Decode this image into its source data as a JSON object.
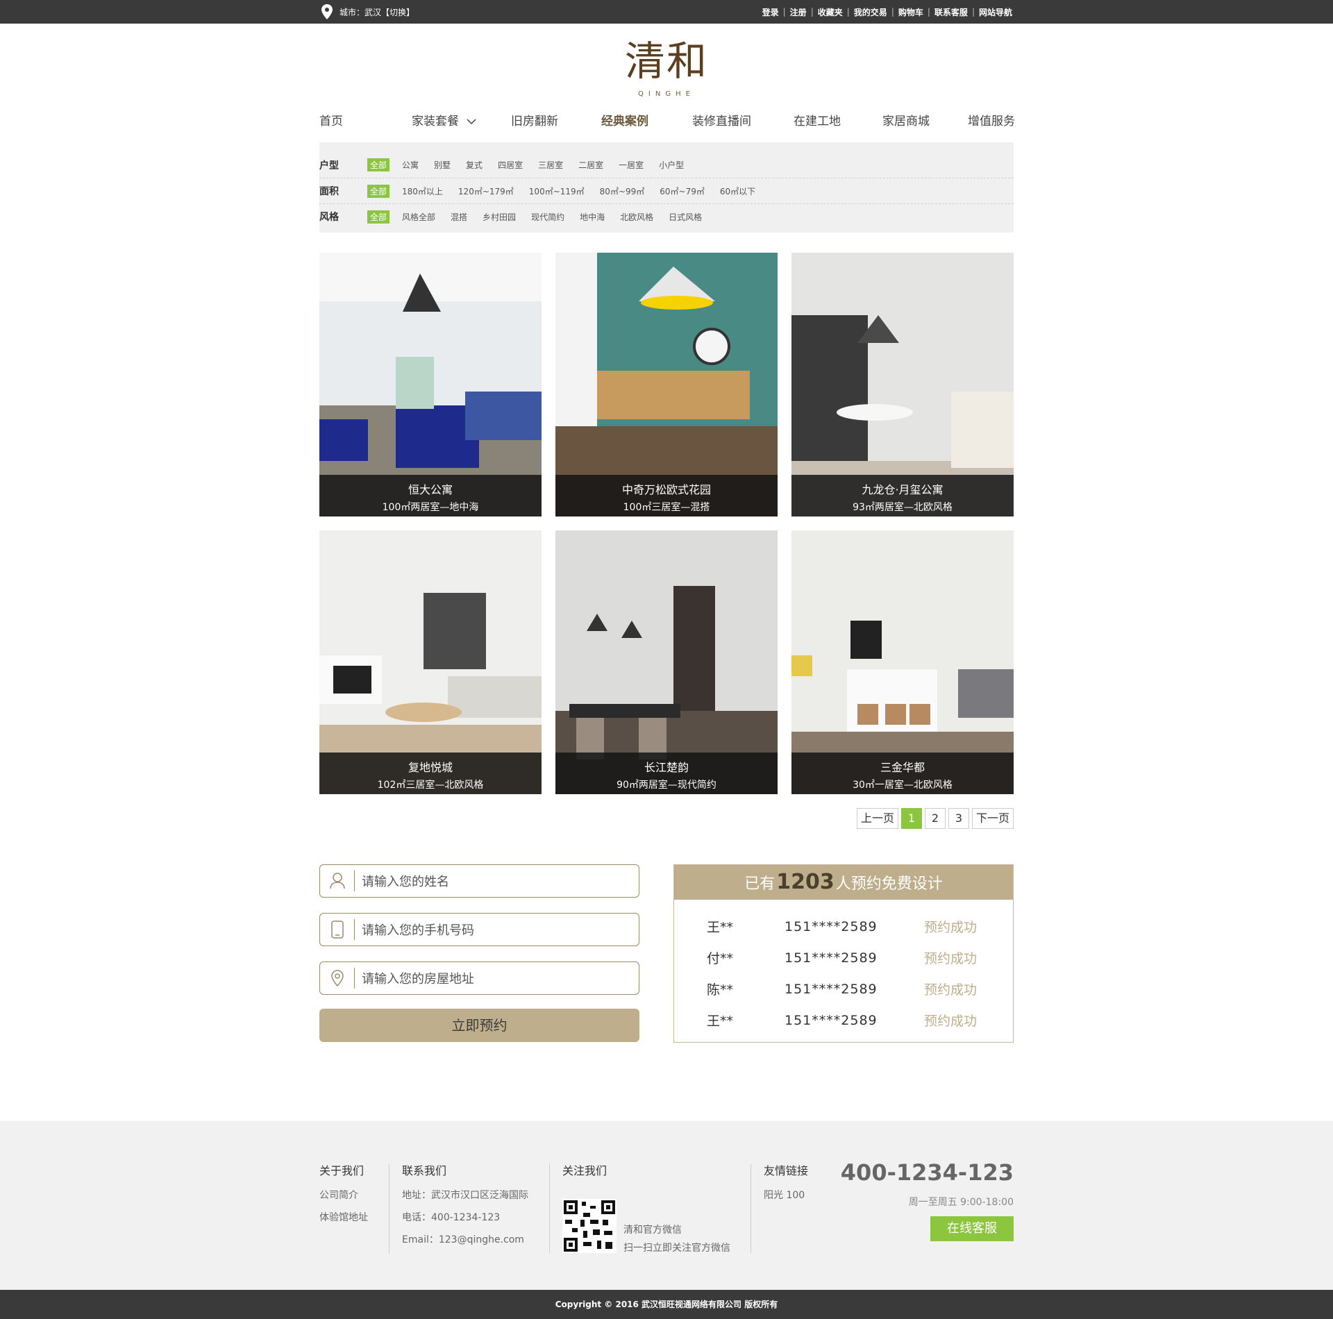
{
  "topbar": {
    "city": "城市：武汉【切换】",
    "links": [
      "登录",
      "注册",
      "收藏夹",
      "我的交易",
      "购物车",
      "联系客服",
      "网站导航"
    ],
    "separator": "|"
  },
  "logo": {
    "mark": "清和",
    "sub": "QINGHE"
  },
  "nav": [
    "首页",
    "家装套餐",
    "旧房翻新",
    "经典案例",
    "装修直播间",
    "在建工地",
    "家居商城",
    "增值服务"
  ],
  "filters": [
    {
      "label": "户型",
      "all": "全部",
      "options": [
        "公寓",
        "别墅",
        "复式",
        "四居室",
        "三居室",
        "二居室",
        "一居室",
        "小户型"
      ]
    },
    {
      "label": "面积",
      "all": "全部",
      "options": [
        "180㎡以上",
        "120㎡~179㎡",
        "100㎡~119㎡",
        "80㎡~99㎡",
        "60㎡~79㎡",
        "60㎡以下"
      ]
    },
    {
      "label": "风格",
      "all": "全部",
      "options": [
        "风格全部",
        "混搭",
        "乡村田园",
        "现代简约",
        "地中海",
        "北欧风格",
        "日式风格"
      ]
    }
  ],
  "cases": [
    {
      "title": "恒大公寓",
      "sub": "100㎡两居室—地中海"
    },
    {
      "title": "中奇万松欧式花园",
      "sub": "100㎡三居室—混搭"
    },
    {
      "title": "九龙仓·月玺公寓",
      "sub": "93㎡两居室—北欧风格"
    },
    {
      "title": "复地悦城",
      "sub": "102㎡三居室—北欧风格"
    },
    {
      "title": "长江楚韵",
      "sub": "90㎡两居室—现代简约"
    },
    {
      "title": "三金华都",
      "sub": "30㎡一居室—北欧风格"
    }
  ],
  "pager": {
    "prev": "上一页",
    "pages": [
      "1",
      "2",
      "3"
    ],
    "current": "1",
    "next": "下一页"
  },
  "form": {
    "name_placeholder": "请输入您的姓名",
    "phone_placeholder": "请输入您的手机号码",
    "address_placeholder": "请输入您的房屋地址",
    "submit": "立即预约"
  },
  "booking": {
    "prefix": "已有",
    "count": "1203",
    "suffix": "人预约免费设计",
    "rows": [
      {
        "name": "王**",
        "phone": "151****2589",
        "status": "预约成功"
      },
      {
        "name": "付**",
        "phone": "151****2589",
        "status": "预约成功"
      },
      {
        "name": "陈**",
        "phone": "151****2589",
        "status": "预约成功"
      },
      {
        "name": "王**",
        "phone": "151****2589",
        "status": "预约成功"
      }
    ]
  },
  "footer": {
    "about": {
      "title": "关于我们",
      "items": [
        "公司简介",
        "体验馆地址"
      ]
    },
    "contact": {
      "title": "联系我们",
      "items": [
        "地址：武汉市汉口区泛海国际",
        "电话：400-1234-123",
        "Email：123@qinghe.com"
      ]
    },
    "follow": {
      "title": "关注我们",
      "items": [
        "清和官方微信",
        "扫一扫立即关注官方微信"
      ]
    },
    "links": {
      "title": "友情链接",
      "items": [
        "阳光 100"
      ]
    },
    "phone": "400-1234-123",
    "hours": "周一至周五  9:00-18:00",
    "online": "在线客服"
  },
  "copyright": "Copyright © 2016 武汉恒旺视通网络有限公司  版权所有",
  "colors": {
    "accent_green": "#8cc63f",
    "gold": "#bfae8c",
    "dark": "#3a3a3a"
  }
}
